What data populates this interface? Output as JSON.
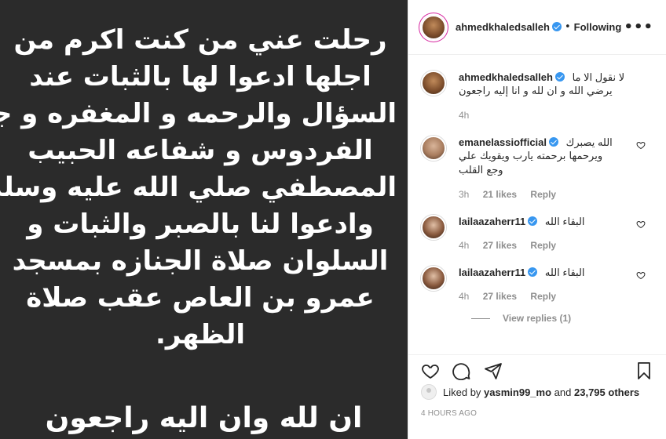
{
  "post_image": {
    "lines": [
      "رحلت عني من كنت اكرم من",
      "اجلها ادعوا لها بالثبات عند",
      "السؤال والرحمه و المغفره و جنة",
      "الفردوس و شفاعه الحبيب",
      "المصطفي صلي الله عليه وسلم",
      "وادعوا لنا بالصبر والثبات و",
      "السلوان صلاة الجنازه بمسجد",
      "عمرو بن العاص عقب صلاة",
      "الظهر."
    ],
    "footer": "ان لله وان اليه راجعون"
  },
  "header": {
    "username": "ahmedkhaledsalleh",
    "separator": "•",
    "follow_status": "Following",
    "more": "•••"
  },
  "caption": {
    "username": "ahmedkhaledsalleh",
    "text_line1": "لا نقول الا ما",
    "text_line2": "يرضي الله و ان لله و انا إليه راجعون",
    "time": "4h"
  },
  "comments": [
    {
      "username": "emanelassiofficial",
      "text_line1": "الله يصبرك",
      "text_line2": "ويرحمها برحمته يارب ويقويك علي",
      "text_line3": "وجع القلب",
      "time": "3h",
      "likes": "21 likes",
      "reply": "Reply"
    },
    {
      "username": "lailaazaherr11",
      "text_line1": "البقاء الله",
      "time": "4h",
      "likes": "27 likes",
      "reply": "Reply"
    },
    {
      "username": "lailaazaherr11",
      "text_line1": "البقاء الله",
      "time": "4h",
      "likes": "27 likes",
      "reply": "Reply"
    }
  ],
  "view_replies": "View replies (1)",
  "likes": {
    "prefix": "Liked by",
    "user": "yasmin99_mo",
    "middle": "and",
    "others": "23,795 others"
  },
  "time_ago": "4 HOURS AGO",
  "colors": {
    "image_bg": "#2b2b2b",
    "verified": "#3897f0",
    "muted": "#8e8e8e"
  }
}
